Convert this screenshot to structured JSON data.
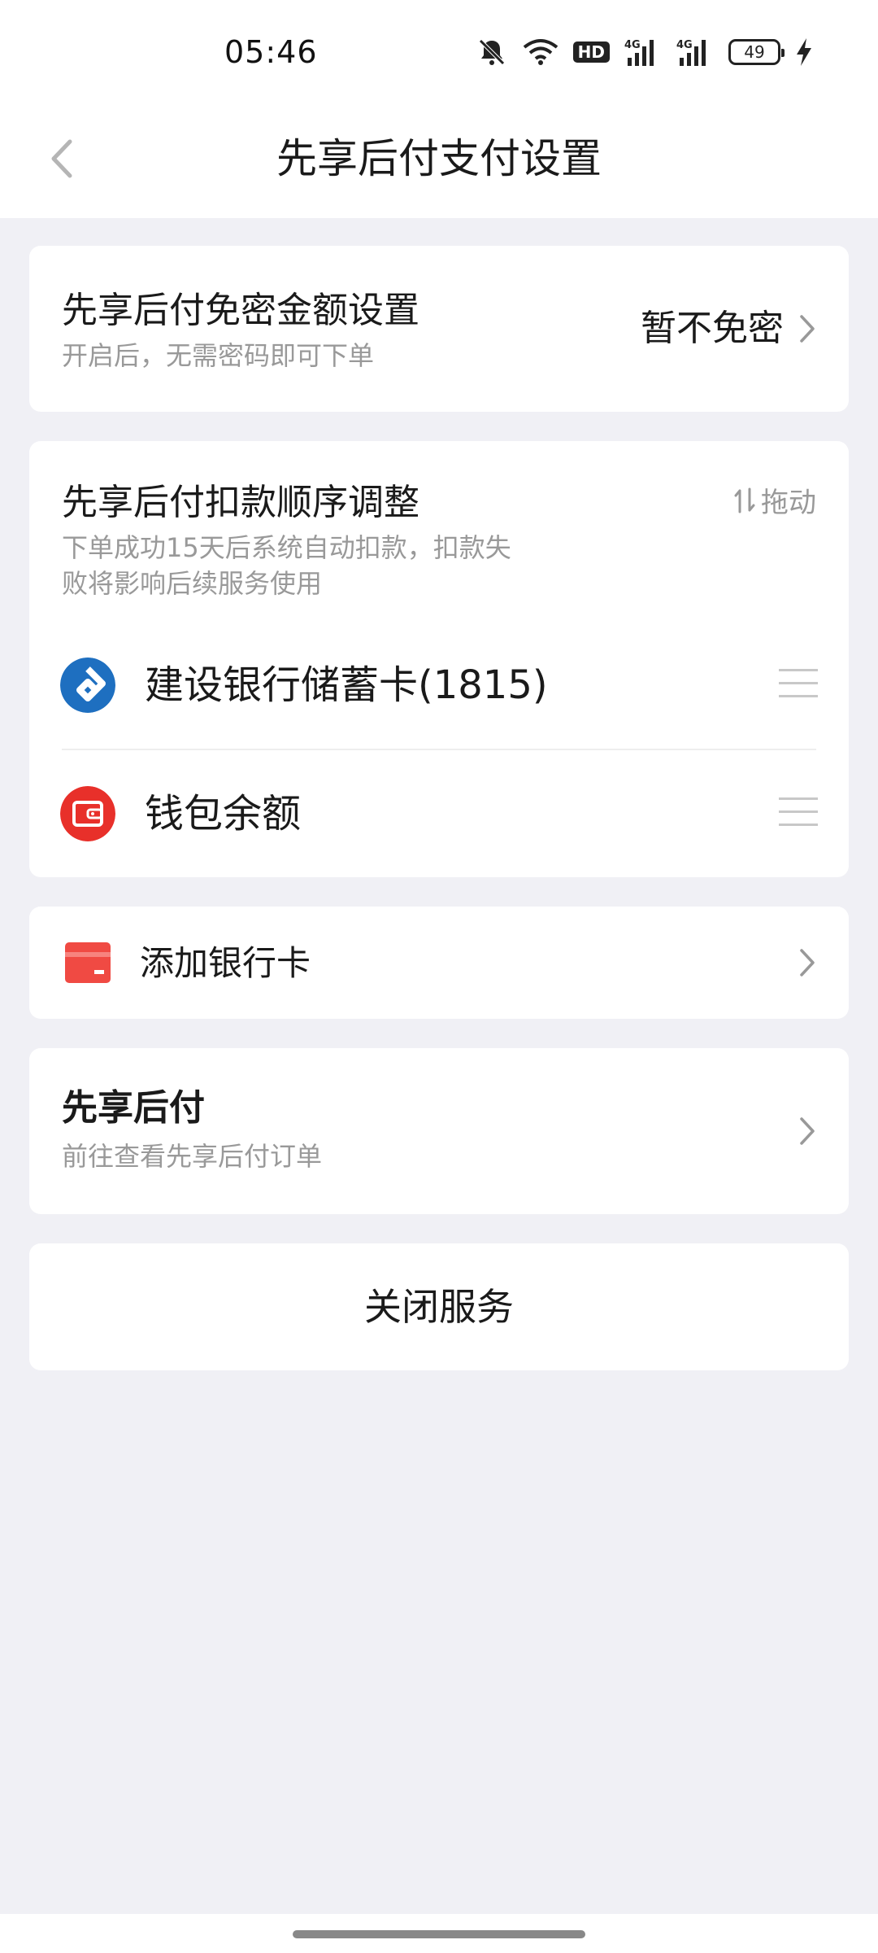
{
  "status_bar": {
    "time": "05:46",
    "hd_label": "HD",
    "battery": "49",
    "icons": [
      "mute-icon",
      "wifi-icon",
      "hd-icon",
      "signal-4g-icon",
      "signal-4g-icon",
      "battery-icon",
      "charging-icon"
    ]
  },
  "nav": {
    "title": "先享后付支付设置",
    "back_icon": "chevron-left-icon"
  },
  "password_free": {
    "title": "先享后付免密金额设置",
    "subtitle": "开启后，无需密码即可下单",
    "value": "暂不免密"
  },
  "deduction_order": {
    "title": "先享后付扣款顺序调整",
    "subtitle_line1": "下单成功15天后系统自动扣款，扣款失",
    "subtitle_line2": "败将影响后续服务使用",
    "drag_label": "拖动",
    "methods": [
      {
        "label": "建设银行储蓄卡(1815)",
        "icon": "ccb-bank-icon",
        "color": "#1e6fc0"
      },
      {
        "label": "钱包余额",
        "icon": "wallet-icon",
        "color": "#e8302a"
      }
    ]
  },
  "add_card": {
    "label": "添加银行卡",
    "icon": "bank-card-icon",
    "color": "#f04a43"
  },
  "orders": {
    "title": "先享后付",
    "subtitle": "前往查看先享后付订单"
  },
  "close_service": {
    "label": "关闭服务"
  }
}
